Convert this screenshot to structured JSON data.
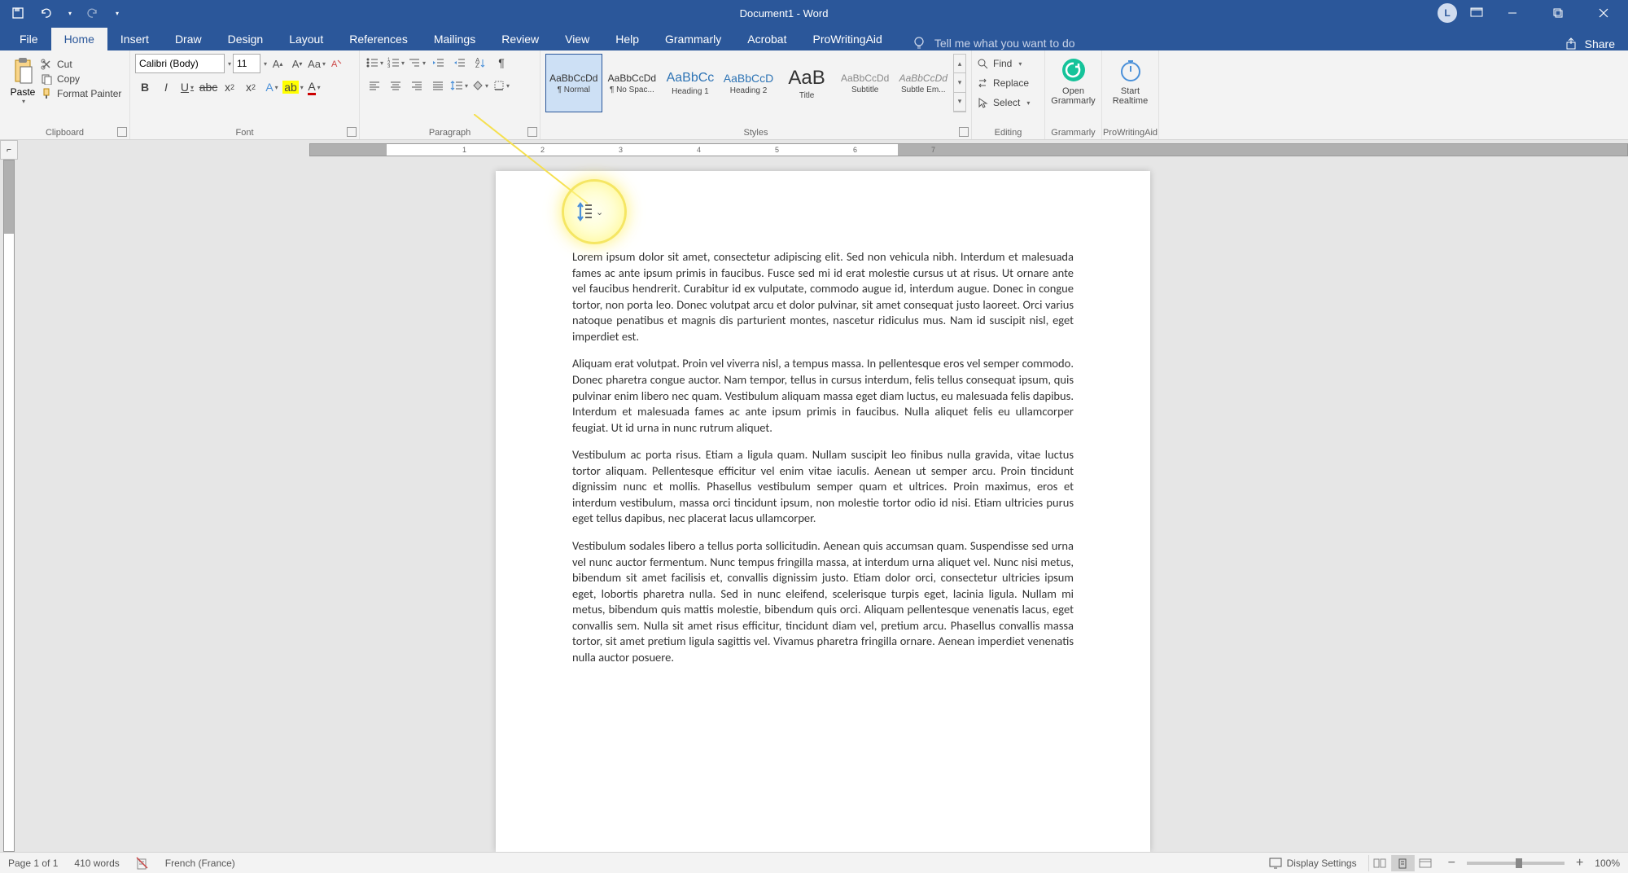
{
  "titlebar": {
    "title": "Document1  -  Word",
    "avatar": "L"
  },
  "tabs": {
    "file": "File",
    "home": "Home",
    "insert": "Insert",
    "draw": "Draw",
    "design": "Design",
    "layout": "Layout",
    "references": "References",
    "mailings": "Mailings",
    "review": "Review",
    "view": "View",
    "help": "Help",
    "grammarly": "Grammarly",
    "acrobat": "Acrobat",
    "prowritingaid": "ProWritingAid",
    "tell_me": "Tell me what you want to do",
    "share": "Share"
  },
  "ribbon": {
    "clipboard": {
      "label": "Clipboard",
      "paste": "Paste",
      "cut": "Cut",
      "copy": "Copy",
      "format_painter": "Format Painter"
    },
    "font": {
      "label": "Font",
      "name": "Calibri (Body)",
      "size": "11"
    },
    "paragraph": {
      "label": "Paragraph"
    },
    "styles": {
      "label": "Styles",
      "items": [
        {
          "preview": "AaBbCcDd",
          "name": "¶ Normal",
          "size": "12px"
        },
        {
          "preview": "AaBbCcDd",
          "name": "¶ No Spac...",
          "size": "12px"
        },
        {
          "preview": "AaBbCc",
          "name": "Heading 1",
          "size": "16px",
          "color": "#2e74b5"
        },
        {
          "preview": "AaBbCcD",
          "name": "Heading 2",
          "size": "14px",
          "color": "#2e74b5"
        },
        {
          "preview": "AaB",
          "name": "Title",
          "size": "24px"
        },
        {
          "preview": "AaBbCcDd",
          "name": "Subtitle",
          "size": "12px",
          "color": "#888"
        },
        {
          "preview": "AaBbCcDd",
          "name": "Subtle Em...",
          "size": "12px",
          "color": "#888",
          "italic": true
        }
      ]
    },
    "editing": {
      "label": "Editing",
      "find": "Find",
      "replace": "Replace",
      "select": "Select"
    },
    "grammarly": {
      "label": "Grammarly",
      "open": "Open Grammarly"
    },
    "prowritingaid": {
      "label": "ProWritingAid",
      "start": "Start Realtime"
    }
  },
  "ruler_marks": [
    "1",
    "2",
    "3",
    "4",
    "5",
    "6",
    "7"
  ],
  "document": {
    "paragraphs": [
      "Lorem ipsum dolor sit amet, consectetur adipiscing elit. Sed non vehicula nibh. Interdum et malesuada fames ac ante ipsum primis in faucibus. Fusce sed mi id erat molestie cursus ut at risus. Ut ornare ante vel faucibus hendrerit. Curabitur id ex vulputate, commodo augue id, interdum augue. Donec in congue tortor, non porta leo. Donec volutpat arcu et dolor pulvinar, sit amet consequat justo laoreet. Orci varius natoque penatibus et magnis dis parturient montes, nascetur ridiculus mus. Nam id suscipit nisl, eget imperdiet est.",
      "Aliquam erat volutpat. Proin vel viverra nisl, a tempus massa. In pellentesque eros vel semper commodo. Donec pharetra congue auctor. Nam tempor, tellus in cursus interdum, felis tellus consequat ipsum, quis pulvinar enim libero nec quam. Vestibulum aliquam massa eget diam luctus, eu malesuada felis dapibus. Interdum et malesuada fames ac ante ipsum primis in faucibus. Nulla aliquet felis eu ullamcorper feugiat. Ut id urna in nunc rutrum aliquet.",
      "Vestibulum ac porta risus. Etiam a ligula quam. Nullam suscipit leo finibus nulla gravida, vitae luctus tortor aliquam. Pellentesque efficitur vel enim vitae iaculis. Aenean ut semper arcu. Proin tincidunt dignissim nunc et mollis. Phasellus vestibulum semper quam et ultrices. Proin maximus, eros et interdum vestibulum, massa orci tincidunt ipsum, non molestie tortor odio id nisi. Etiam ultricies purus eget tellus dapibus, nec placerat lacus ullamcorper.",
      "Vestibulum sodales libero a tellus porta sollicitudin. Aenean quis accumsan quam. Suspendisse sed urna vel nunc auctor fermentum. Nunc tempus fringilla massa, at interdum urna aliquet vel. Nunc nisi metus, bibendum sit amet facilisis et, convallis dignissim justo. Etiam dolor orci, consectetur ultricies ipsum eget, lobortis pharetra nulla. Sed in nunc eleifend, scelerisque turpis eget, lacinia ligula. Nullam mi metus, bibendum quis mattis molestie, bibendum quis orci. Aliquam pellentesque venenatis lacus, eget convallis sem. Nulla sit amet risus efficitur, tincidunt diam vel, pretium arcu. Phasellus convallis massa tortor, sit amet pretium ligula sagittis vel. Vivamus pharetra fringilla ornare. Aenean imperdiet venenatis nulla auctor posuere."
    ]
  },
  "statusbar": {
    "page": "Page 1 of 1",
    "words": "410 words",
    "language": "French (France)",
    "display_settings": "Display Settings",
    "zoom": "100%"
  }
}
